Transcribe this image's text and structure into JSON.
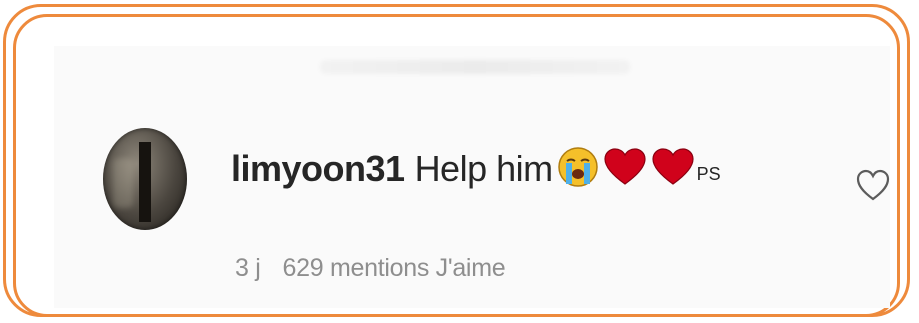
{
  "comment": {
    "username": "limyoon31",
    "text": "Help him",
    "suffix": "PS",
    "emojis": [
      "crying-face-emoji",
      "red-heart-emoji",
      "red-heart-emoji"
    ]
  },
  "meta": {
    "age": "3 j",
    "likes": "629 mentions J'aime"
  },
  "colors": {
    "frame": "#ee8a3c",
    "text": "#262626",
    "meta": "#8e8e8e",
    "heart": "#d0021b"
  },
  "icons": {
    "like": "heart-outline-icon"
  }
}
